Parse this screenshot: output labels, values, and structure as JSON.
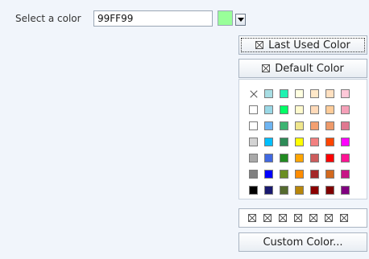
{
  "form": {
    "label": "Select a color",
    "input_value": "99FF99",
    "preview_color": "#99FF99"
  },
  "popup": {
    "last_used_label": "Last Used Color",
    "default_label": "Default Color",
    "custom_label": "Custom Color...",
    "palette": [
      [
        "none",
        "#A8DEE4",
        "#1EF2B0",
        "#FFFFE0",
        "#FFE8C8",
        "#FFE0C0",
        "#FFC8D8"
      ],
      [
        "#FFFFFF",
        "#9AD8E6",
        "#00FF66",
        "#FFFACD",
        "#FFDAB9",
        "#FFCC99",
        "#F5A0B8"
      ],
      [
        "#FFFFFF",
        "#6FB5F2",
        "#3CB371",
        "#F0E68C",
        "#F4A070",
        "#EE9A6A",
        "#E07890"
      ],
      [
        "#D3D3D3",
        "#00BFFF",
        "#2E8B57",
        "#FFFF00",
        "#F28080",
        "#FF4500",
        "#FF00FF"
      ],
      [
        "#A9A9A9",
        "#4169E1",
        "#228B22",
        "#FFA500",
        "#CD5C5C",
        "#FF0000",
        "#FF1493"
      ],
      [
        "#808080",
        "#0000FF",
        "#6B8E23",
        "#FF8C00",
        "#A52A2A",
        "#D2691E",
        "#C71585"
      ],
      [
        "#000000",
        "#191970",
        "#556B2F",
        "#B8860B",
        "#8B0000",
        "#800000",
        "#800080"
      ]
    ],
    "recent_slots": [
      "none",
      "none",
      "none",
      "none",
      "none",
      "none",
      "none"
    ]
  }
}
